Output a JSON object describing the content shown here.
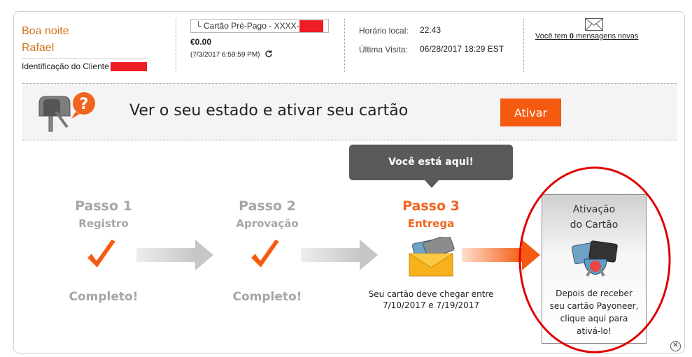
{
  "header": {
    "greeting": "Boa noite",
    "user_name": "Rafael",
    "client_id_label": "Identificação do Cliente",
    "card_select": "Cartão Pré-Pago - XXXX-",
    "balance": "€0.00",
    "balance_time": "(7/3/2017 6:59:59 PM)",
    "local_time_label": "Horário local:",
    "local_time_value": "22:43",
    "last_visit_label": "Última Visita:",
    "last_visit_value": "06/28/2017 18:29 EST",
    "messages_prefix": "Você tem ",
    "messages_count": "0",
    "messages_suffix": " mensagens novas"
  },
  "banner": {
    "title": "Ver o seu estado e ativar seu cartão",
    "button": "Ativar"
  },
  "tooltip": "Você está aqui!",
  "steps": [
    {
      "title": "Passo 1",
      "sub": "Registro",
      "status": "Completo!"
    },
    {
      "title": "Passo 2",
      "sub": "Aprovação",
      "status": "Completo!"
    },
    {
      "title": "Passo 3",
      "sub": "Entrega",
      "note_line1": "Seu cartão deve chegar entre",
      "note_line2": "7/10/2017 e 7/19/2017"
    }
  ],
  "activation": {
    "title_line1": "Ativação",
    "title_line2": "do Cartão",
    "desc_line1": "Depois de receber",
    "desc_line2": "seu cartão Payoneer,",
    "desc_line3": "clique aqui para",
    "desc_line4": "ativá-lo!"
  },
  "colors": {
    "accent": "#f45a10",
    "greeting": "#d4731a",
    "redaction": "#ee1c25",
    "highlight_circle": "#e00000"
  }
}
